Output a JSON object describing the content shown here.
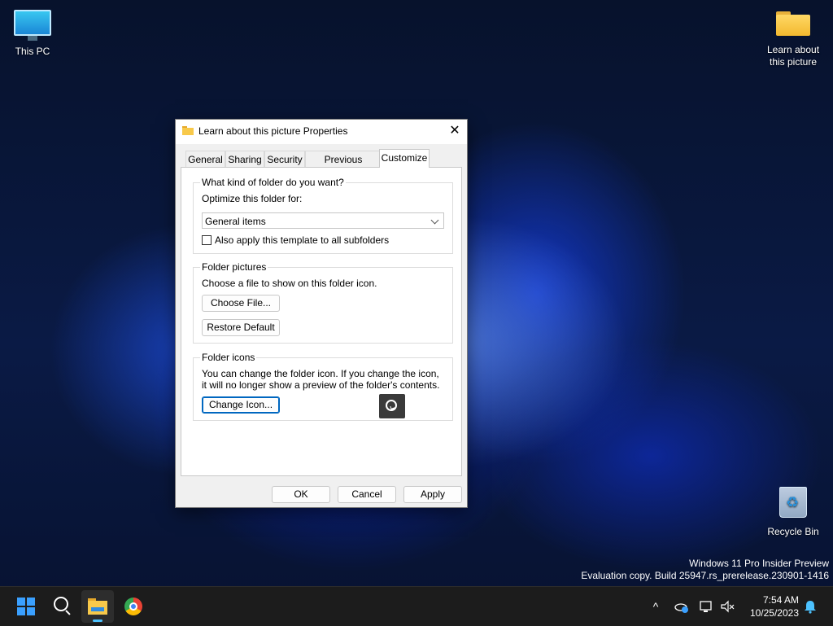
{
  "desktop": {
    "icons": [
      {
        "label": "This PC",
        "icon": "monitor-icon"
      },
      {
        "label": "Learn about\nthis picture",
        "label_line1": "Learn about",
        "label_line2": "this picture",
        "icon": "folder-icon"
      },
      {
        "label": "Recycle Bin",
        "icon": "recycle-bin-icon"
      }
    ],
    "watermark": {
      "line1": "Windows 11 Pro Insider Preview",
      "line2": "Evaluation copy. Build 25947.rs_prerelease.230901-1416"
    }
  },
  "dialog": {
    "title": "Learn about this picture Properties",
    "close_symbol": "✕",
    "tabs": [
      {
        "label": "General"
      },
      {
        "label": "Sharing"
      },
      {
        "label": "Security"
      },
      {
        "label": "Previous Versions"
      },
      {
        "label": "Customize",
        "selected": true
      }
    ],
    "folder_type": {
      "heading": "What kind of folder do you want?",
      "optimize_label": "Optimize this folder for:",
      "selected_option": "General items",
      "apply_subfolders_label": "Also apply this template to all subfolders",
      "apply_subfolders_checked": false
    },
    "folder_pictures": {
      "heading": "Folder pictures",
      "description": "Choose a file to show on this folder icon.",
      "choose_file_button": "Choose File...",
      "restore_default_button": "Restore Default"
    },
    "folder_icons": {
      "heading": "Folder icons",
      "description": "You can change the folder icon. If you change the icon, it will no longer show a preview of the folder's contents.",
      "change_icon_button": "Change Icon..."
    },
    "buttons": {
      "ok": "OK",
      "cancel": "Cancel",
      "apply": "Apply"
    }
  },
  "taskbar": {
    "apps": [
      {
        "name": "start-button",
        "icon": "windows-logo-icon"
      },
      {
        "name": "search-button",
        "icon": "search-icon"
      },
      {
        "name": "file-explorer",
        "icon": "folder-icon",
        "active": true
      },
      {
        "name": "chrome",
        "icon": "chrome-icon"
      }
    ],
    "tray": {
      "chevron": "^",
      "time": "7:54 AM",
      "date": "10/25/2023"
    }
  },
  "colors": {
    "accent": "#0067c0",
    "taskbar": "#1c1c1c",
    "dialog_bg": "#f0f0f0"
  }
}
